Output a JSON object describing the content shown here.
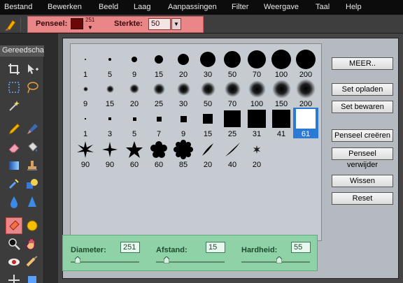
{
  "menu": {
    "items": [
      "Bestand",
      "Bewerken",
      "Beeld",
      "Laag",
      "Aanpassingen",
      "Filter",
      "Weergave",
      "Taal",
      "Help"
    ]
  },
  "options": {
    "brush_label": "Penseel:",
    "brush_size": "251",
    "strength_label": "Sterkte:",
    "strength_value": "50",
    "brush_color": "#6a0808",
    "highlight_color": "#e98688"
  },
  "toolbox": {
    "title": "Gereedschap"
  },
  "brush_presets": [
    {
      "label": "1",
      "shape": "dot",
      "size": 1
    },
    {
      "label": "5",
      "shape": "dot",
      "size": 5
    },
    {
      "label": "9",
      "shape": "dot",
      "size": 9
    },
    {
      "label": "15",
      "shape": "dot",
      "size": 15
    },
    {
      "label": "20",
      "shape": "dot",
      "size": 20
    },
    {
      "label": "30",
      "shape": "dot",
      "size": 30
    },
    {
      "label": "50",
      "shape": "dot",
      "size": 50
    },
    {
      "label": "70",
      "shape": "dot",
      "size": 70
    },
    {
      "label": "100",
      "shape": "dot",
      "size": 100
    },
    {
      "label": "200",
      "shape": "dot",
      "size": 200
    },
    {
      "label": "9",
      "shape": "soft",
      "size": 9
    },
    {
      "label": "15",
      "shape": "soft",
      "size": 15
    },
    {
      "label": "20",
      "shape": "soft",
      "size": 20
    },
    {
      "label": "25",
      "shape": "soft",
      "size": 25
    },
    {
      "label": "30",
      "shape": "soft",
      "size": 30
    },
    {
      "label": "50",
      "shape": "soft",
      "size": 50
    },
    {
      "label": "70",
      "shape": "soft",
      "size": 70
    },
    {
      "label": "100",
      "shape": "soft",
      "size": 100
    },
    {
      "label": "150",
      "shape": "soft",
      "size": 150
    },
    {
      "label": "200",
      "shape": "soft",
      "size": 200
    },
    {
      "label": "1",
      "shape": "square",
      "size": 1
    },
    {
      "label": "3",
      "shape": "square",
      "size": 3
    },
    {
      "label": "5",
      "shape": "square",
      "size": 5
    },
    {
      "label": "7",
      "shape": "square",
      "size": 7
    },
    {
      "label": "9",
      "shape": "square",
      "size": 9
    },
    {
      "label": "15",
      "shape": "square",
      "size": 15
    },
    {
      "label": "25",
      "shape": "square",
      "size": 25
    },
    {
      "label": "31",
      "shape": "square",
      "size": 31
    },
    {
      "label": "41",
      "shape": "square",
      "size": 41
    },
    {
      "label": "61",
      "shape": "square",
      "size": 61,
      "selected": true
    },
    {
      "label": "90",
      "shape": "star8",
      "icon": "star-burst-icon"
    },
    {
      "label": "90",
      "shape": "star4",
      "icon": "four-point-star-icon"
    },
    {
      "label": "60",
      "shape": "star5",
      "icon": "star-icon"
    },
    {
      "label": "60",
      "shape": "flower5",
      "icon": "flower-icon"
    },
    {
      "label": "85",
      "shape": "flower8",
      "icon": "daisy-icon"
    },
    {
      "label": "20",
      "shape": "leaf",
      "icon": "leaf-stroke-icon"
    },
    {
      "label": "40",
      "shape": "leaf2",
      "icon": "long-leaf-stroke-icon"
    },
    {
      "label": "20",
      "shape": "starsmall",
      "icon": "small-star-icon"
    }
  ],
  "buttons": {
    "more": "MEER..",
    "load": "Set opladen",
    "save": "Set bewaren",
    "create": "Penseel creëren",
    "delete": "Penseel verwijder",
    "clear": "Wissen",
    "reset": "Reset"
  },
  "sliders": {
    "diameter_label": "Diameter:",
    "diameter_value": "251",
    "diameter_level": 0.1,
    "spacing_label": "Afstand:",
    "spacing_value": "15",
    "spacing_level": 0.15,
    "hardness_label": "Hardheid:",
    "hardness_value": "55",
    "hardness_level": 0.55,
    "panel_color": "#8fd2a8"
  }
}
